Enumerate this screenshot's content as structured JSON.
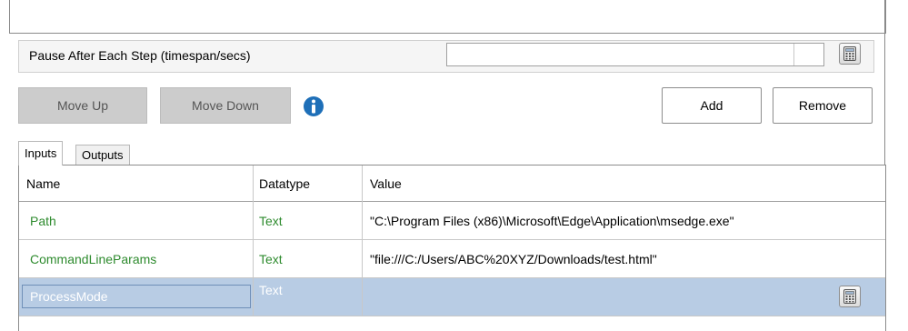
{
  "pause": {
    "label": "Pause After Each Step (timespan/secs)",
    "value": ""
  },
  "buttons": {
    "move_up": "Move Up",
    "move_down": "Move Down",
    "add": "Add",
    "remove": "Remove"
  },
  "tabs": [
    {
      "label": "Inputs",
      "active": true
    },
    {
      "label": "Outputs",
      "active": false
    }
  ],
  "grid": {
    "columns": [
      "Name",
      "Datatype",
      "Value"
    ],
    "rows": [
      {
        "name": "Path",
        "datatype": "Text",
        "value": "\"C:\\Program Files (x86)\\Microsoft\\Edge\\Application\\msedge.exe\""
      },
      {
        "name": "CommandLineParams",
        "datatype": "Text",
        "value": "\"file:///C:/Users/ABC%20XYZ/Downloads/test.html\""
      },
      {
        "name": "ProcessMode",
        "datatype": "Text",
        "value": ""
      }
    ]
  },
  "icons": {
    "info": "info-icon",
    "calculator": "calculator-icon"
  },
  "colors": {
    "name_text": "#2e8b2e",
    "selected_row": "#b8cce4",
    "info_icon": "#1e6fb8"
  }
}
